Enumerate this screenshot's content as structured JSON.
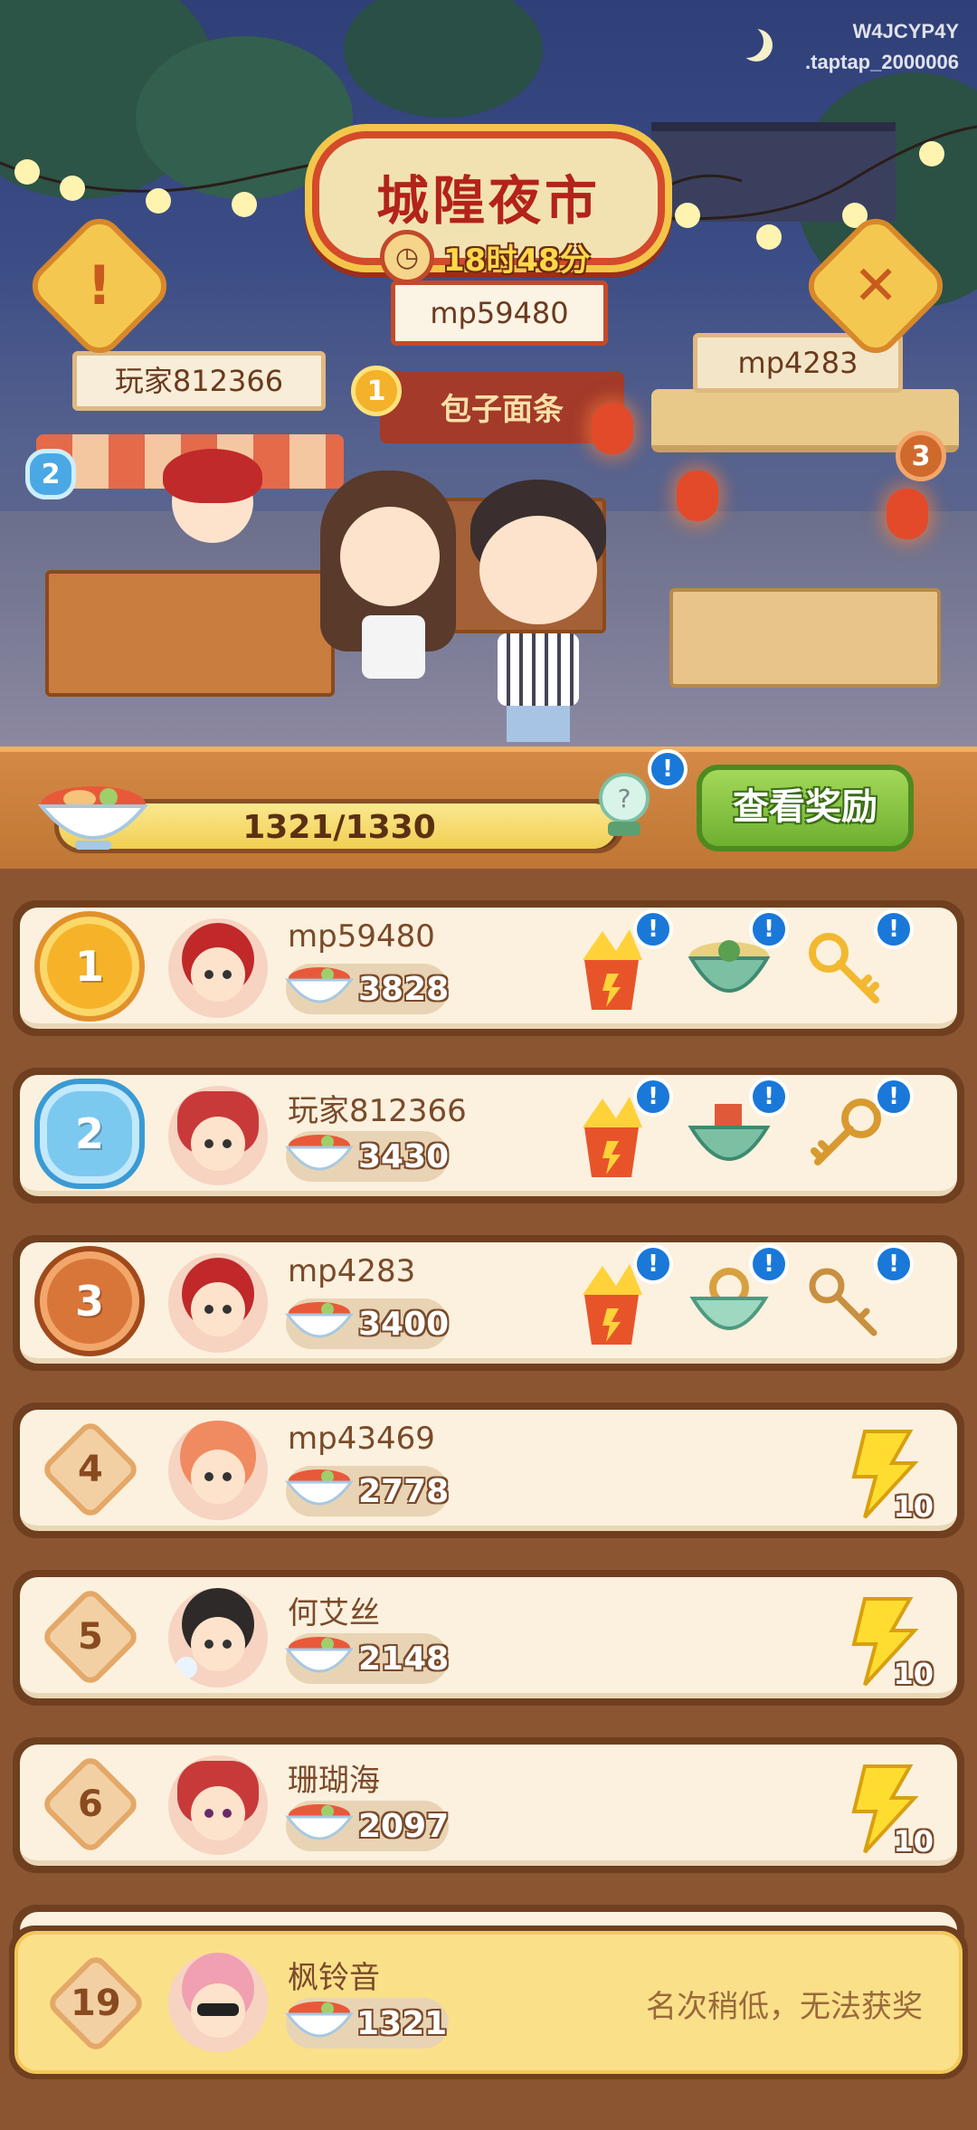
{
  "header": {
    "watermark_line1": "W4JCYP4Y",
    "watermark_line2": ".taptap_2000006",
    "title": "城隍夜市",
    "timer": "18时48分",
    "center_sign": "mp59480",
    "left_sign": "玩家812366",
    "right_sign": "mp4283",
    "stall_sign": "包子面条",
    "alert_icon": "exclamation-icon",
    "close_icon": "close-x-icon",
    "rank_markers": [
      "1",
      "2",
      "3"
    ]
  },
  "progress": {
    "current": 1321,
    "max": 1330,
    "label": "1321/1330",
    "reward_button": "查看奖励"
  },
  "leaderboard": [
    {
      "rank": "1",
      "name": "mp59480",
      "score": "3828",
      "rewards": [
        "gold-bolt-chest-icon",
        "jade-treasure-bowl-icon",
        "gold-key-icon"
      ]
    },
    {
      "rank": "2",
      "name": "玩家812366",
      "score": "3430",
      "rewards": [
        "gold-bolt-chest-icon",
        "jade-treasure-bowl-icon",
        "gold-key-icon"
      ]
    },
    {
      "rank": "3",
      "name": "mp4283",
      "score": "3400",
      "rewards": [
        "gold-bolt-chest-icon",
        "jade-coin-bowl-icon",
        "gold-key-icon"
      ]
    },
    {
      "rank": "4",
      "name": "mp43469",
      "score": "2778",
      "bolt_count": "10"
    },
    {
      "rank": "5",
      "name": "何艾丝",
      "score": "2148",
      "bolt_count": "10"
    },
    {
      "rank": "6",
      "name": "珊瑚海",
      "score": "2097",
      "bolt_count": "10"
    }
  ],
  "self": {
    "rank": "19",
    "name": "枫铃音",
    "score": "1321",
    "message": "名次稍低，无法获奖"
  },
  "colors": {
    "panel_brown": "#8c5532",
    "row_cream": "#fbf1de",
    "self_yellow": "#fbe08a",
    "reward_green": "#6eb030",
    "info_blue": "#1a78d8"
  }
}
